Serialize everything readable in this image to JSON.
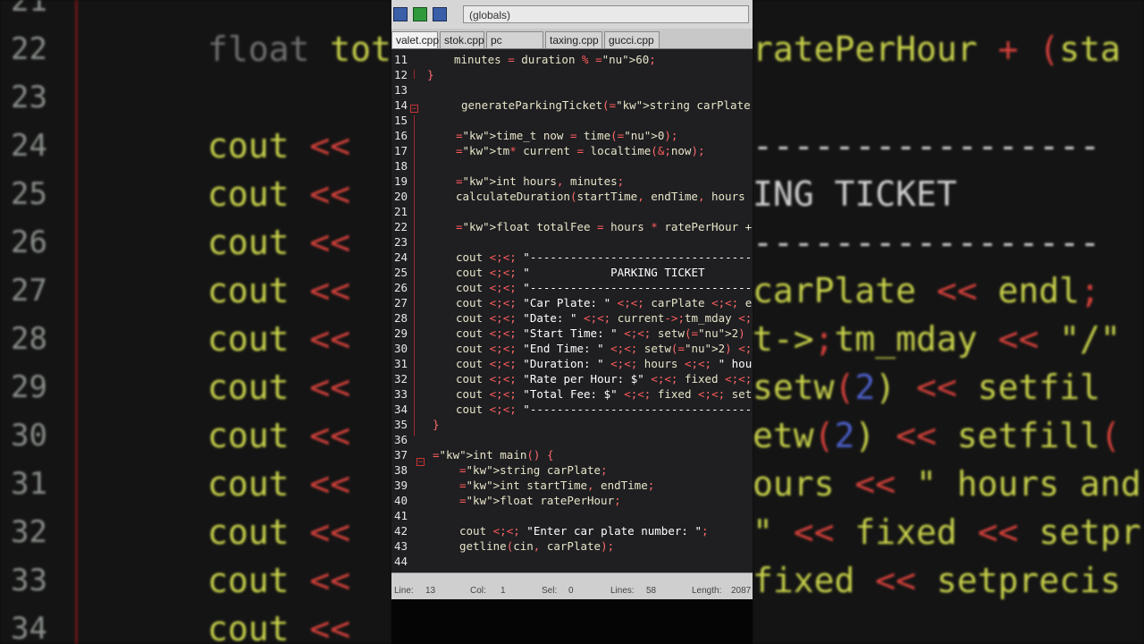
{
  "toolbar": {
    "scope": "(globals)"
  },
  "tabs": [
    {
      "label": "valet.cpp",
      "active": true
    },
    {
      "label": "stok.cpp",
      "active": false
    },
    {
      "label": "pc lab.cpp",
      "active": false
    },
    {
      "label": "taxing.cpp",
      "active": false
    },
    {
      "label": "gucci.cpp",
      "active": false
    }
  ],
  "code": [
    {
      "n": "11",
      "t": "minutes = duration % 60;"
    },
    {
      "n": "12",
      "t": "}"
    },
    {
      "n": "13",
      "t": ""
    },
    {
      "n": "14",
      "t": "generateParkingTicket(string carPlate,"
    },
    {
      "n": "15",
      "t": ""
    },
    {
      "n": "16",
      "t": "time_t now = time(0);"
    },
    {
      "n": "17",
      "t": "tm* current = localtime(&now);"
    },
    {
      "n": "18",
      "t": ""
    },
    {
      "n": "19",
      "t": "int hours, minutes;"
    },
    {
      "n": "20",
      "t": "calculateDuration(startTime, endTime, hours"
    },
    {
      "n": "21",
      "t": ""
    },
    {
      "n": "22",
      "t": "float totalFee = hours * ratePerHour + (sta"
    },
    {
      "n": "23",
      "t": ""
    },
    {
      "n": "24",
      "t": "cout << \"---------------------------------"
    },
    {
      "n": "25",
      "t": "cout << \"            PARKING TICKET"
    },
    {
      "n": "26",
      "t": "cout << \"---------------------------------"
    },
    {
      "n": "27",
      "t": "cout << \"Car Plate: \" << carPlate << endl;"
    },
    {
      "n": "28",
      "t": "cout << \"Date: \" << current->tm_mday << \"/\""
    },
    {
      "n": "29",
      "t": "cout << \"Start Time: \" << setw(2) << setfil"
    },
    {
      "n": "30",
      "t": "cout << \"End Time: \" << setw(2) << setfill("
    },
    {
      "n": "31",
      "t": "cout << \"Duration: \" << hours << \" hours and"
    },
    {
      "n": "32",
      "t": "cout << \"Rate per Hour: $\" << fixed << setpr"
    },
    {
      "n": "33",
      "t": "cout << \"Total Fee: $\" << fixed << setprecis"
    },
    {
      "n": "34",
      "t": "cout << \"---------------------------------"
    },
    {
      "n": "35",
      "t": "}"
    },
    {
      "n": "36",
      "t": ""
    },
    {
      "n": "37",
      "t": "int main() {"
    },
    {
      "n": "38",
      "t": "string carPlate;"
    },
    {
      "n": "39",
      "t": "int startTime, endTime;"
    },
    {
      "n": "40",
      "t": "float ratePerHour;"
    },
    {
      "n": "41",
      "t": ""
    },
    {
      "n": "42",
      "t": "cout << \"Enter car plate number: \";"
    },
    {
      "n": "43",
      "t": "getline(cin, carPlate);"
    },
    {
      "n": "44",
      "t": ""
    }
  ],
  "status": {
    "line_label": "Line:",
    "line_value": "13",
    "col_label": "Col:",
    "col_value": "1",
    "sel_label": "Sel:",
    "sel_value": "0",
    "lines_label": "Lines:",
    "lines_value": "58",
    "length_label": "Length:",
    "length_value": "2087"
  },
  "background_left": {
    "rows": [
      {
        "n": "21",
        "t": ""
      },
      {
        "n": "22",
        "t": "float tot"
      },
      {
        "n": "23",
        "t": ""
      },
      {
        "n": "24",
        "t": "cout <<"
      },
      {
        "n": "25",
        "t": "cout <<"
      },
      {
        "n": "26",
        "t": "cout <<"
      },
      {
        "n": "27",
        "t": "cout <<"
      },
      {
        "n": "28",
        "t": "cout <<"
      },
      {
        "n": "29",
        "t": "cout <<"
      },
      {
        "n": "30",
        "t": "cout <<"
      },
      {
        "n": "31",
        "t": "cout <<"
      },
      {
        "n": "32",
        "t": "cout <<"
      },
      {
        "n": "33",
        "t": "cout <<"
      },
      {
        "n": "34",
        "t": "cout <<"
      }
    ]
  },
  "background_right": {
    "rows": [
      {
        "t": ""
      },
      {
        "t": "ratePerHour + (sta"
      },
      {
        "t": ""
      },
      {
        "t": "-----------------"
      },
      {
        "t": "ING TICKET"
      },
      {
        "t": "-----------------"
      },
      {
        "t": "carPlate << endl;"
      },
      {
        "t": "t->tm_mday << \"/\""
      },
      {
        "t": "setw(2) << setfil"
      },
      {
        "t": "etw(2) << setfill("
      },
      {
        "t": "ours << \" hours and"
      },
      {
        "t": "\" << fixed << setpr"
      },
      {
        "t": "fixed << setprecis"
      },
      {
        "t": ""
      }
    ]
  }
}
